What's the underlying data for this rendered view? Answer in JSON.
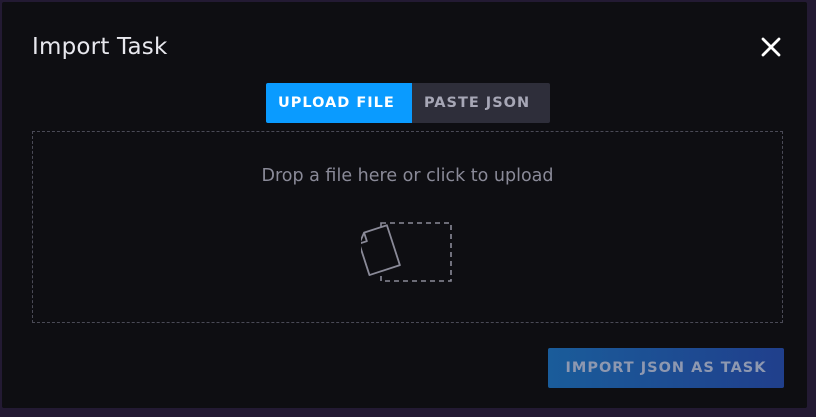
{
  "modal": {
    "title": "Import Task",
    "close_icon": "close-icon"
  },
  "tabs": [
    {
      "label": "UPLOAD FILE",
      "active": true
    },
    {
      "label": "PASTE JSON",
      "active": false
    }
  ],
  "dropzone": {
    "text": "Drop a file here or click to upload",
    "icon": "file-upload-icon"
  },
  "footer": {
    "import_button_label": "IMPORT JSON AS TASK",
    "import_button_disabled": true
  },
  "colors": {
    "accent": "#0a9bff",
    "background": "#0e0e12",
    "tab_inactive": "#2e2e3a"
  }
}
